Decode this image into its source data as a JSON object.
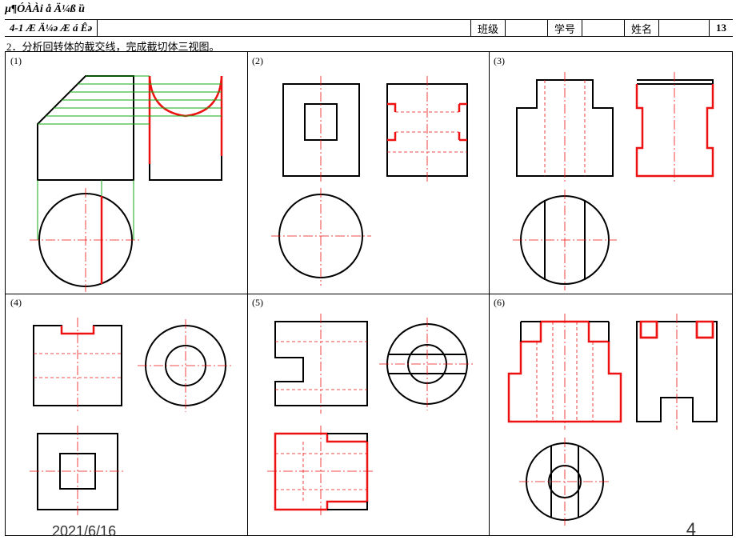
{
  "topTitle": "µ¶ÓÀÀi å Ä¼ß ȕ",
  "sectionTitle": "4-1  Æ Ä¼ǝ Æ á Êǝ  ",
  "header": {
    "class": "班级",
    "id": "学号",
    "name": "姓名",
    "page": "13"
  },
  "question": "2．分析回转体的截交线，完成截切体三视图。",
  "markers": {
    "m1": "(1)",
    "m2": "(2)",
    "m3": "(3)",
    "m4": "(4)",
    "m5": "(5)",
    "m6": "(6)"
  },
  "footer": {
    "date": "2021/6/16",
    "page": "4"
  }
}
